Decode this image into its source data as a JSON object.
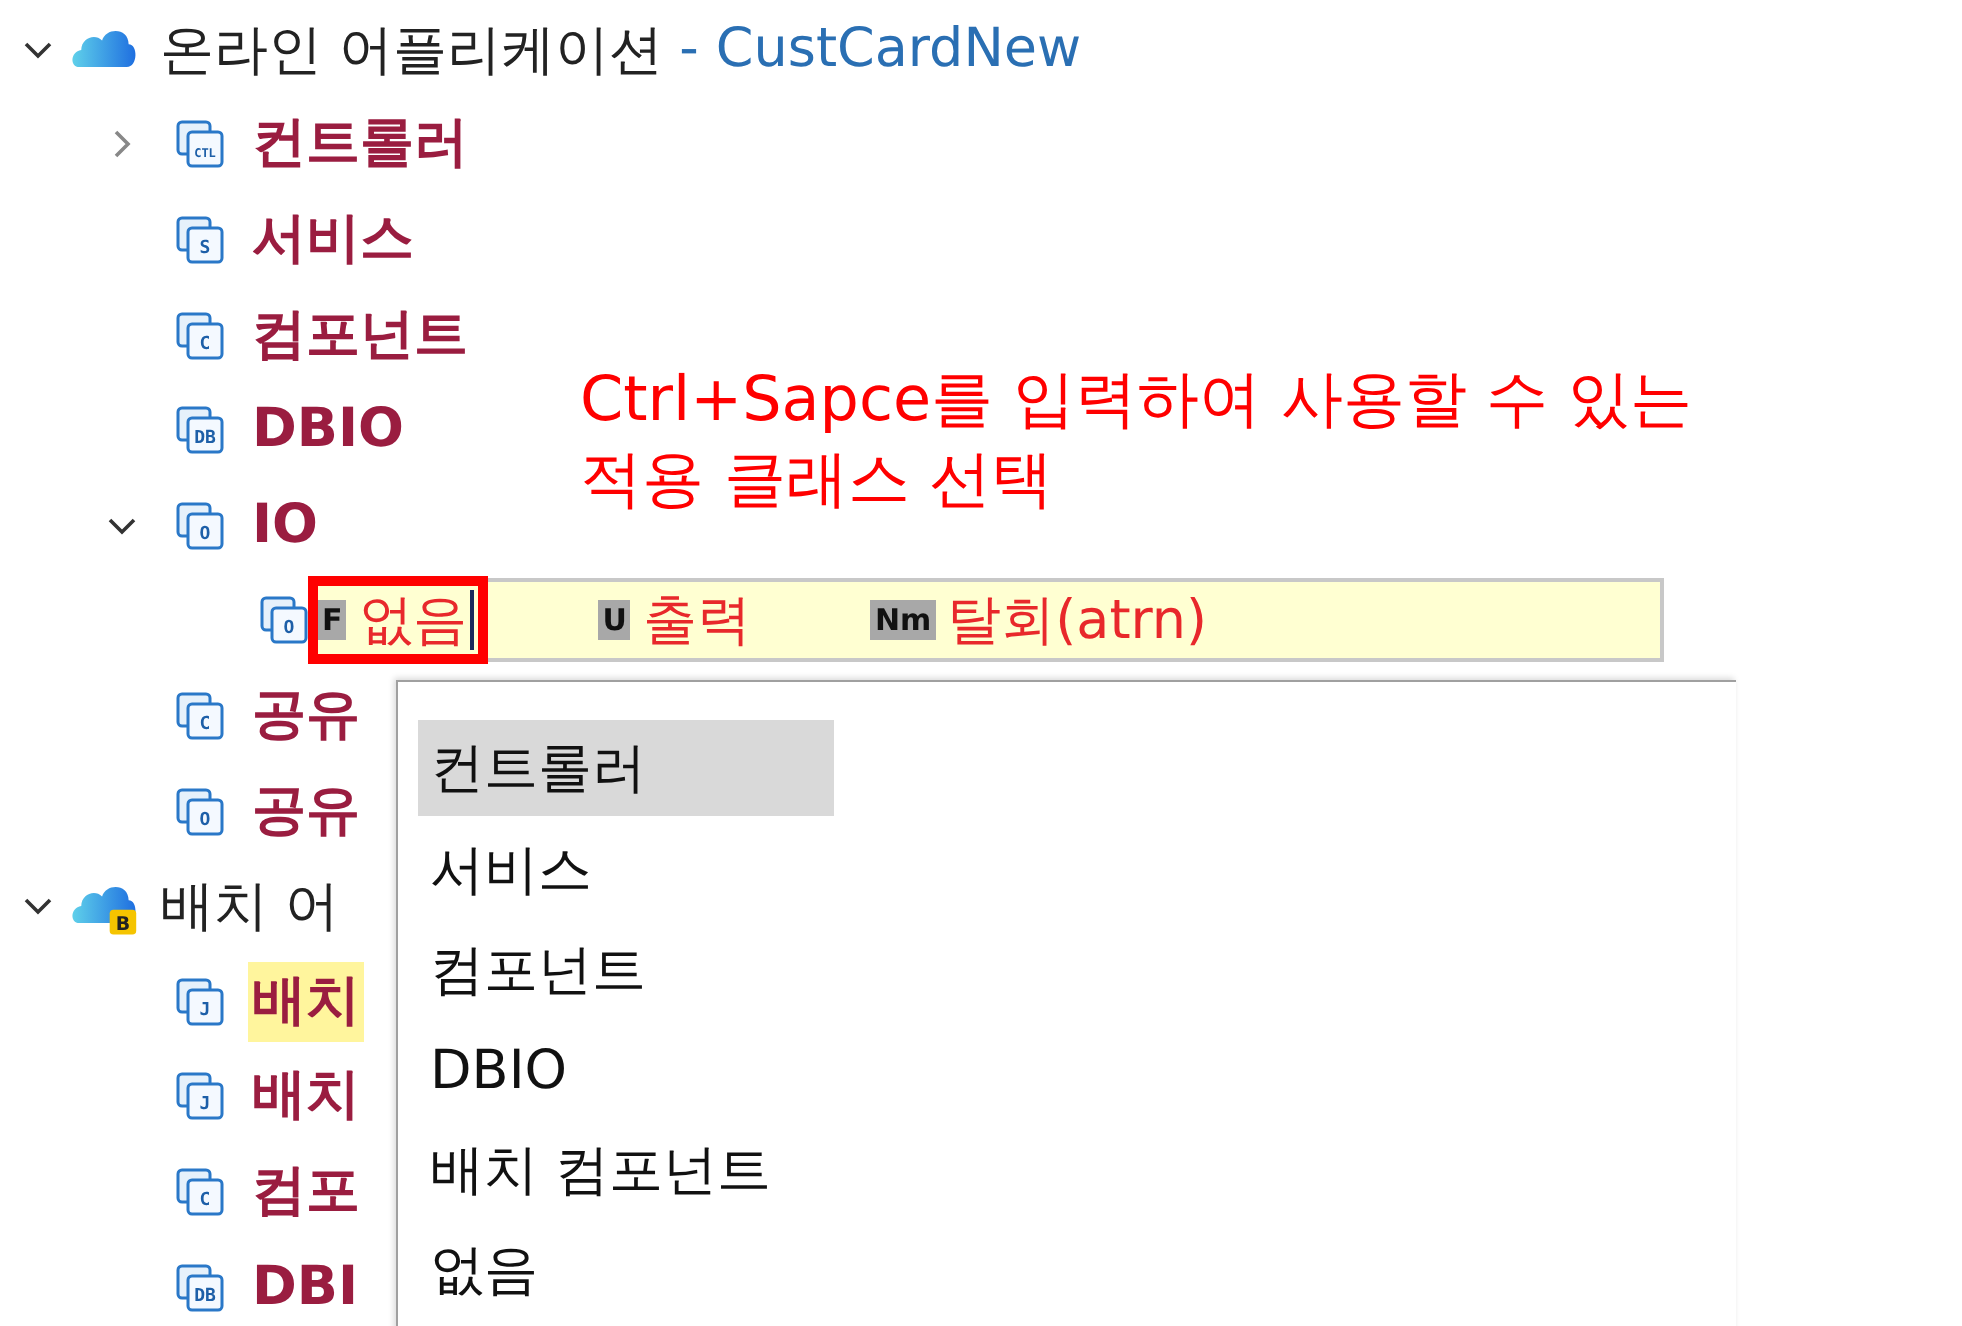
{
  "tree": [
    {
      "kind": "app",
      "label": "온라인 어플리케이션",
      "project": "- CustCardNew",
      "expanded": true,
      "children": [
        {
          "kind": "item",
          "icon_text": "CTL",
          "label": "컨트롤러",
          "expanded": false
        },
        {
          "kind": "item",
          "icon_text": "S",
          "label": "서비스"
        },
        {
          "kind": "item",
          "icon_text": "C",
          "label": "컴포넌트"
        },
        {
          "kind": "item",
          "icon_text": "DB",
          "label": "DBIO"
        },
        {
          "kind": "item",
          "icon_text": "O",
          "label": "IO",
          "expanded": true,
          "children": [
            {
              "kind": "editor",
              "icon_text": "O",
              "segments": [
                {
                  "flag": "F",
                  "text": "없음",
                  "boxed": true,
                  "cursor": true
                },
                {
                  "flag": "U",
                  "text": "출력",
                  "boxed": false,
                  "cursor": false
                },
                {
                  "flag": "Nm",
                  "text": "탈회(atrn)",
                  "boxed": false,
                  "cursor": false
                }
              ]
            }
          ]
        },
        {
          "kind": "item",
          "icon_text": "C",
          "label": "공유"
        },
        {
          "kind": "item",
          "icon_text": "O",
          "label": "공유"
        }
      ]
    },
    {
      "kind": "app",
      "label": "배치 어",
      "badge": "B",
      "expanded": true,
      "children": [
        {
          "kind": "item",
          "icon_text": "J",
          "label": "배치",
          "highlighted": true
        },
        {
          "kind": "item",
          "icon_text": "J",
          "label": "배치",
          "highlighted": false
        },
        {
          "kind": "item",
          "icon_text": "C",
          "label": "컴포"
        },
        {
          "kind": "item",
          "icon_text": "DB",
          "label": "DBI"
        }
      ]
    }
  ],
  "annotation": [
    "Ctrl+Sapce를 입력하여 사용할 수 있는",
    "적용 클래스 선택"
  ],
  "popup": {
    "items": [
      {
        "label": "컨트롤러",
        "selected": true
      },
      {
        "label": "서비스",
        "selected": false
      },
      {
        "label": "컴포넌트",
        "selected": false
      },
      {
        "label": "DBIO",
        "selected": false
      },
      {
        "label": "배치 컴포넌트",
        "selected": false
      },
      {
        "label": "없음",
        "selected": false
      }
    ]
  }
}
